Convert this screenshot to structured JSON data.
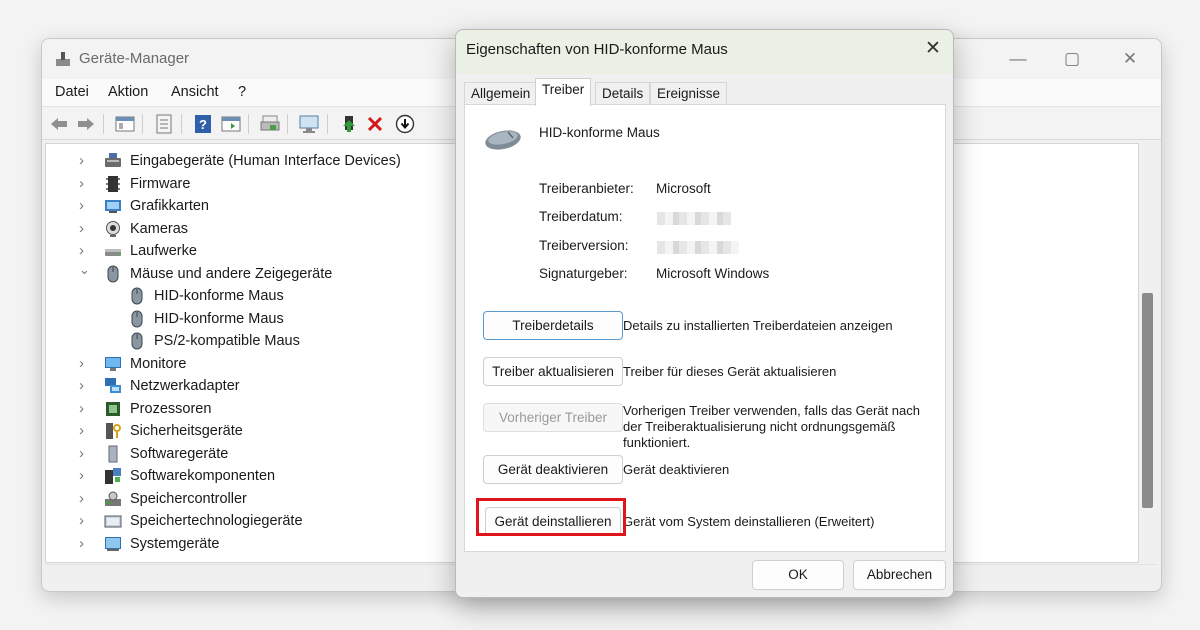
{
  "device_manager": {
    "title": "Geräte-Manager",
    "menu": [
      "Datei",
      "Aktion",
      "Ansicht",
      "?"
    ],
    "toolbar_icons": [
      "back-icon",
      "forward-icon",
      "properties-view-icon",
      "device-list-icon",
      "help-icon",
      "action-view-icon",
      "print-icon",
      "scan-hardware-icon",
      "add-driver-icon",
      "uninstall-icon",
      "disable-icon"
    ],
    "tree": [
      {
        "label": "Eingabegeräte (Human Interface Devices)",
        "icon": "hid-icon",
        "level": 0,
        "expanded": false
      },
      {
        "label": "Firmware",
        "icon": "firmware-icon",
        "level": 0,
        "expanded": false
      },
      {
        "label": "Grafikkarten",
        "icon": "display-adapter-icon",
        "level": 0,
        "expanded": false
      },
      {
        "label": "Kameras",
        "icon": "camera-icon",
        "level": 0,
        "expanded": false
      },
      {
        "label": "Laufwerke",
        "icon": "drive-icon",
        "level": 0,
        "expanded": false
      },
      {
        "label": "Mäuse und andere Zeigegeräte",
        "icon": "mouse-icon",
        "level": 0,
        "expanded": true
      },
      {
        "label": "HID-konforme Maus",
        "icon": "mouse-icon",
        "level": 1
      },
      {
        "label": "HID-konforme Maus",
        "icon": "mouse-icon",
        "level": 1
      },
      {
        "label": "PS/2-kompatible Maus",
        "icon": "mouse-icon",
        "level": 1
      },
      {
        "label": "Monitore",
        "icon": "monitor-icon",
        "level": 0,
        "expanded": false
      },
      {
        "label": "Netzwerkadapter",
        "icon": "network-adapter-icon",
        "level": 0,
        "expanded": false
      },
      {
        "label": "Prozessoren",
        "icon": "processor-icon",
        "level": 0,
        "expanded": false
      },
      {
        "label": "Sicherheitsgeräte",
        "icon": "security-device-icon",
        "level": 0,
        "expanded": false
      },
      {
        "label": "Softwaregeräte",
        "icon": "software-device-icon",
        "level": 0,
        "expanded": false
      },
      {
        "label": "Softwarekomponenten",
        "icon": "software-component-icon",
        "level": 0,
        "expanded": false
      },
      {
        "label": "Speichercontroller",
        "icon": "storage-controller-icon",
        "level": 0,
        "expanded": false
      },
      {
        "label": "Speichertechnologiegeräte",
        "icon": "memory-technology-icon",
        "level": 0,
        "expanded": false
      },
      {
        "label": "Systemgeräte",
        "icon": "system-device-icon",
        "level": 0,
        "expanded": false
      }
    ]
  },
  "dialog": {
    "title": "Eigenschaften von HID-konforme Maus",
    "tabs": [
      "Allgemein",
      "Treiber",
      "Details",
      "Ereignisse"
    ],
    "active_tab": "Treiber",
    "device_name": "HID-konforme Maus",
    "driver_info": [
      {
        "key": "Treiberanbieter:",
        "value": "Microsoft"
      },
      {
        "key": "Treiberdatum:",
        "value": ""
      },
      {
        "key": "Treiberversion:",
        "value": ""
      },
      {
        "key": "Signaturgeber:",
        "value": "Microsoft Windows"
      }
    ],
    "actions": [
      {
        "button": "Treiberdetails",
        "description": "Details zu installierten Treiberdateien anzeigen",
        "enabled": true
      },
      {
        "button": "Treiber aktualisieren",
        "description": "Treiber für dieses Gerät aktualisieren",
        "enabled": true
      },
      {
        "button": "Vorheriger Treiber",
        "description": "Vorherigen Treiber verwenden, falls das Gerät nach der Treiberaktualisierung nicht ordnungsgemäß funktioniert.",
        "enabled": false
      },
      {
        "button": "Gerät deaktivieren",
        "description": "Gerät deaktivieren",
        "enabled": true
      },
      {
        "button": "Gerät deinstallieren",
        "description": "Gerät vom System deinstallieren (Erweitert)",
        "enabled": true
      }
    ],
    "ok_label": "OK",
    "cancel_label": "Abbrechen",
    "highlight_color": "#e0151b"
  }
}
